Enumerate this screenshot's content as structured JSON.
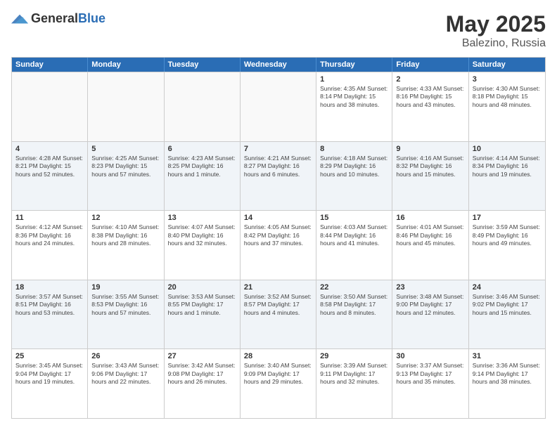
{
  "header": {
    "logo_general": "General",
    "logo_blue": "Blue",
    "title": "May 2025",
    "location": "Balezino, Russia"
  },
  "weekdays": [
    "Sunday",
    "Monday",
    "Tuesday",
    "Wednesday",
    "Thursday",
    "Friday",
    "Saturday"
  ],
  "rows": [
    [
      {
        "day": "",
        "info": "",
        "empty": true
      },
      {
        "day": "",
        "info": "",
        "empty": true
      },
      {
        "day": "",
        "info": "",
        "empty": true
      },
      {
        "day": "",
        "info": "",
        "empty": true
      },
      {
        "day": "1",
        "info": "Sunrise: 4:35 AM\nSunset: 8:14 PM\nDaylight: 15 hours\nand 38 minutes."
      },
      {
        "day": "2",
        "info": "Sunrise: 4:33 AM\nSunset: 8:16 PM\nDaylight: 15 hours\nand 43 minutes."
      },
      {
        "day": "3",
        "info": "Sunrise: 4:30 AM\nSunset: 8:18 PM\nDaylight: 15 hours\nand 48 minutes."
      }
    ],
    [
      {
        "day": "4",
        "info": "Sunrise: 4:28 AM\nSunset: 8:21 PM\nDaylight: 15 hours\nand 52 minutes."
      },
      {
        "day": "5",
        "info": "Sunrise: 4:25 AM\nSunset: 8:23 PM\nDaylight: 15 hours\nand 57 minutes."
      },
      {
        "day": "6",
        "info": "Sunrise: 4:23 AM\nSunset: 8:25 PM\nDaylight: 16 hours\nand 1 minute."
      },
      {
        "day": "7",
        "info": "Sunrise: 4:21 AM\nSunset: 8:27 PM\nDaylight: 16 hours\nand 6 minutes."
      },
      {
        "day": "8",
        "info": "Sunrise: 4:18 AM\nSunset: 8:29 PM\nDaylight: 16 hours\nand 10 minutes."
      },
      {
        "day": "9",
        "info": "Sunrise: 4:16 AM\nSunset: 8:32 PM\nDaylight: 16 hours\nand 15 minutes."
      },
      {
        "day": "10",
        "info": "Sunrise: 4:14 AM\nSunset: 8:34 PM\nDaylight: 16 hours\nand 19 minutes."
      }
    ],
    [
      {
        "day": "11",
        "info": "Sunrise: 4:12 AM\nSunset: 8:36 PM\nDaylight: 16 hours\nand 24 minutes."
      },
      {
        "day": "12",
        "info": "Sunrise: 4:10 AM\nSunset: 8:38 PM\nDaylight: 16 hours\nand 28 minutes."
      },
      {
        "day": "13",
        "info": "Sunrise: 4:07 AM\nSunset: 8:40 PM\nDaylight: 16 hours\nand 32 minutes."
      },
      {
        "day": "14",
        "info": "Sunrise: 4:05 AM\nSunset: 8:42 PM\nDaylight: 16 hours\nand 37 minutes."
      },
      {
        "day": "15",
        "info": "Sunrise: 4:03 AM\nSunset: 8:44 PM\nDaylight: 16 hours\nand 41 minutes."
      },
      {
        "day": "16",
        "info": "Sunrise: 4:01 AM\nSunset: 8:46 PM\nDaylight: 16 hours\nand 45 minutes."
      },
      {
        "day": "17",
        "info": "Sunrise: 3:59 AM\nSunset: 8:49 PM\nDaylight: 16 hours\nand 49 minutes."
      }
    ],
    [
      {
        "day": "18",
        "info": "Sunrise: 3:57 AM\nSunset: 8:51 PM\nDaylight: 16 hours\nand 53 minutes."
      },
      {
        "day": "19",
        "info": "Sunrise: 3:55 AM\nSunset: 8:53 PM\nDaylight: 16 hours\nand 57 minutes."
      },
      {
        "day": "20",
        "info": "Sunrise: 3:53 AM\nSunset: 8:55 PM\nDaylight: 17 hours\nand 1 minute."
      },
      {
        "day": "21",
        "info": "Sunrise: 3:52 AM\nSunset: 8:57 PM\nDaylight: 17 hours\nand 4 minutes."
      },
      {
        "day": "22",
        "info": "Sunrise: 3:50 AM\nSunset: 8:58 PM\nDaylight: 17 hours\nand 8 minutes."
      },
      {
        "day": "23",
        "info": "Sunrise: 3:48 AM\nSunset: 9:00 PM\nDaylight: 17 hours\nand 12 minutes."
      },
      {
        "day": "24",
        "info": "Sunrise: 3:46 AM\nSunset: 9:02 PM\nDaylight: 17 hours\nand 15 minutes."
      }
    ],
    [
      {
        "day": "25",
        "info": "Sunrise: 3:45 AM\nSunset: 9:04 PM\nDaylight: 17 hours\nand 19 minutes."
      },
      {
        "day": "26",
        "info": "Sunrise: 3:43 AM\nSunset: 9:06 PM\nDaylight: 17 hours\nand 22 minutes."
      },
      {
        "day": "27",
        "info": "Sunrise: 3:42 AM\nSunset: 9:08 PM\nDaylight: 17 hours\nand 26 minutes."
      },
      {
        "day": "28",
        "info": "Sunrise: 3:40 AM\nSunset: 9:09 PM\nDaylight: 17 hours\nand 29 minutes."
      },
      {
        "day": "29",
        "info": "Sunrise: 3:39 AM\nSunset: 9:11 PM\nDaylight: 17 hours\nand 32 minutes."
      },
      {
        "day": "30",
        "info": "Sunrise: 3:37 AM\nSunset: 9:13 PM\nDaylight: 17 hours\nand 35 minutes."
      },
      {
        "day": "31",
        "info": "Sunrise: 3:36 AM\nSunset: 9:14 PM\nDaylight: 17 hours\nand 38 minutes."
      }
    ]
  ]
}
